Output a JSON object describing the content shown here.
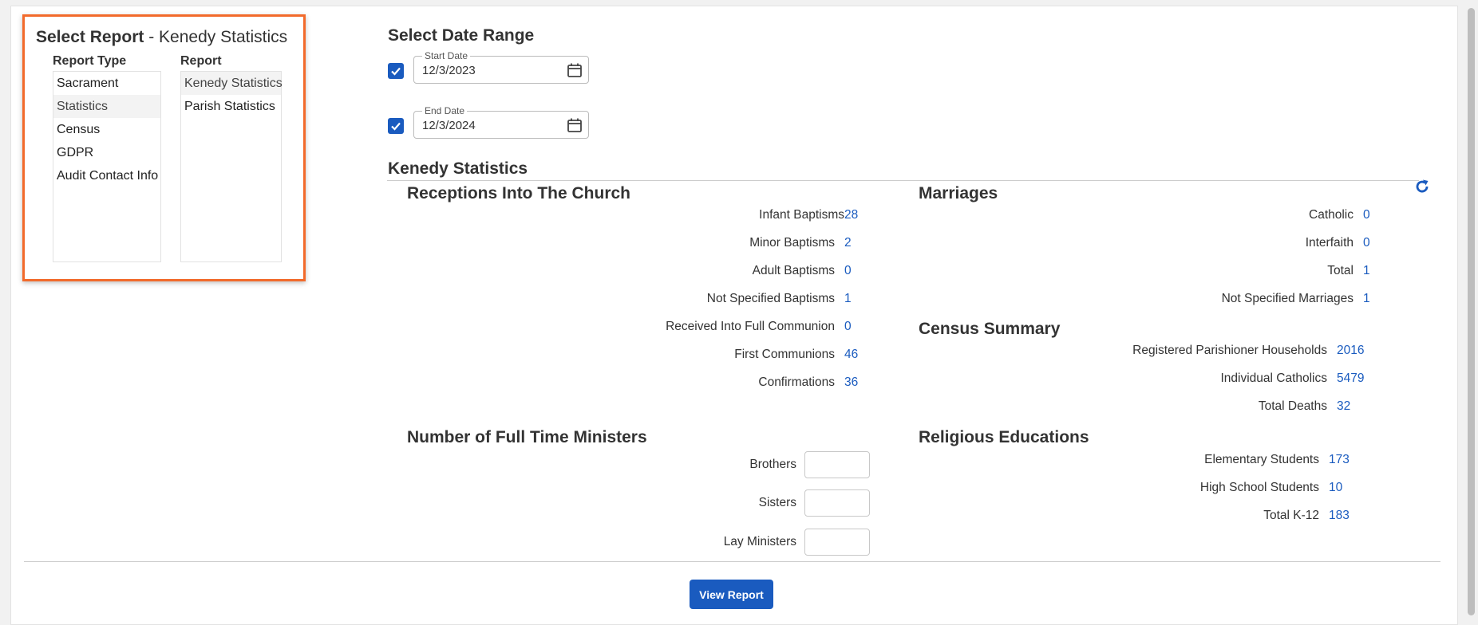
{
  "report_select": {
    "title": "Select Report",
    "separator": " - ",
    "selected_report": "Kenedy Statistics",
    "report_type_label": "Report Type",
    "report_label": "Report",
    "report_types": [
      "Sacrament",
      "Statistics",
      "Census",
      "GDPR",
      "Audit Contact Info"
    ],
    "reports": [
      "Kenedy Statistics",
      "Parish Statistics"
    ]
  },
  "date_range": {
    "title": "Select Date Range",
    "start_label": "Start Date",
    "start_value": "12/3/2023",
    "end_label": "End Date",
    "end_value": "12/3/2024"
  },
  "report": {
    "title": "Kenedy Statistics",
    "receptions": {
      "title": "Receptions Into The Church",
      "rows": [
        {
          "label": "Infant Baptisms",
          "value": "28"
        },
        {
          "label": "Minor Baptisms",
          "value": "2"
        },
        {
          "label": "Adult Baptisms",
          "value": "0"
        },
        {
          "label": "Not Specified Baptisms",
          "value": "1"
        },
        {
          "label": "Received Into Full Communion",
          "value": "0"
        },
        {
          "label": "First Communions",
          "value": "46"
        },
        {
          "label": "Confirmations",
          "value": "36"
        }
      ]
    },
    "marriages": {
      "title": "Marriages",
      "rows": [
        {
          "label": "Catholic",
          "value": "0"
        },
        {
          "label": "Interfaith",
          "value": "0"
        },
        {
          "label": "Total",
          "value": "1"
        },
        {
          "label": "Not Specified Marriages",
          "value": "1"
        }
      ]
    },
    "census": {
      "title": "Census Summary",
      "rows": [
        {
          "label": "Registered Parishioner Households",
          "value": "2016"
        },
        {
          "label": "Individual Catholics",
          "value": "5479"
        },
        {
          "label": "Total Deaths",
          "value": "32"
        }
      ]
    },
    "ministers": {
      "title": "Number of Full Time Ministers",
      "rows": [
        {
          "label": "Brothers",
          "value": ""
        },
        {
          "label": "Sisters",
          "value": ""
        },
        {
          "label": "Lay Ministers",
          "value": ""
        }
      ]
    },
    "religious_ed": {
      "title": "Religious Educations",
      "rows": [
        {
          "label": "Elementary Students",
          "value": "173"
        },
        {
          "label": "High School Students",
          "value": "10"
        },
        {
          "label": "Total K-12",
          "value": "183"
        }
      ]
    }
  },
  "actions": {
    "view_report": "View Report"
  },
  "colors": {
    "accent": "#1a5bbf",
    "highlight_border": "#f26a2b"
  }
}
